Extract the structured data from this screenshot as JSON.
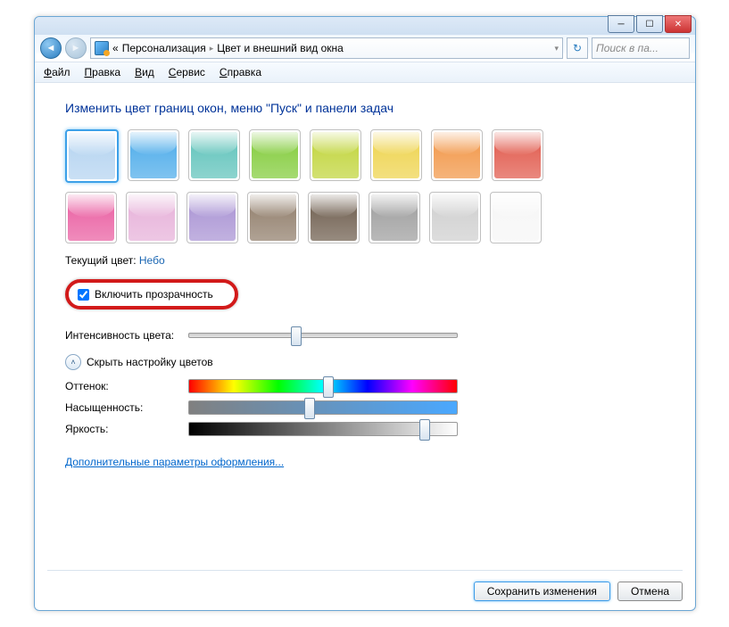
{
  "nav": {
    "back_glyph": "◄",
    "fwd_glyph": "►",
    "seg_prefix": "«",
    "seg1": "Персонализация",
    "seg2": "Цвет и внешний вид окна",
    "sep": "▸",
    "dropdown_glyph": "▾",
    "refresh_glyph": "↻"
  },
  "search": {
    "placeholder": "Поиск в па..."
  },
  "menu": {
    "file": "Файл",
    "edit": "Правка",
    "view": "Вид",
    "tools": "Сервис",
    "help": "Справка"
  },
  "heading": "Изменить цвет границ окон, меню \"Пуск\" и панели задач",
  "swatches": [
    {
      "color": "#bcd8f2",
      "sel": true
    },
    {
      "color": "#5fb4ec"
    },
    {
      "color": "#70c9c2"
    },
    {
      "color": "#8fd14f"
    },
    {
      "color": "#c7d94f"
    },
    {
      "color": "#f0d860"
    },
    {
      "color": "#f3a15a"
    },
    {
      "color": "#e46a5e"
    },
    {
      "color": "#ec6fab"
    },
    {
      "color": "#e9b9dd"
    },
    {
      "color": "#b29ed8"
    },
    {
      "color": "#9c8b7a"
    },
    {
      "color": "#7d6e60"
    },
    {
      "color": "#a8a8a8"
    },
    {
      "color": "#d4d4d4"
    },
    {
      "color": "#f7f7f7"
    }
  ],
  "current": {
    "label": "Текущий цвет:",
    "value": "Небо"
  },
  "transparency": {
    "label": "Включить прозрачность",
    "checked": true
  },
  "intensity": {
    "label": "Интенсивность цвета:",
    "pos_pct": 40
  },
  "expander": {
    "label": "Скрыть настройку цветов",
    "glyph": "˄"
  },
  "hue": {
    "label": "Оттенок:",
    "pos_pct": 52
  },
  "sat": {
    "label": "Насыщенность:",
    "pos_pct": 45
  },
  "bri": {
    "label": "Яркость:",
    "pos_pct": 88
  },
  "advanced_link": "Дополнительные параметры оформления...",
  "buttons": {
    "save": "Сохранить изменения",
    "cancel": "Отмена"
  },
  "winbtns": {
    "min": "─",
    "max": "☐",
    "close": "✕"
  }
}
